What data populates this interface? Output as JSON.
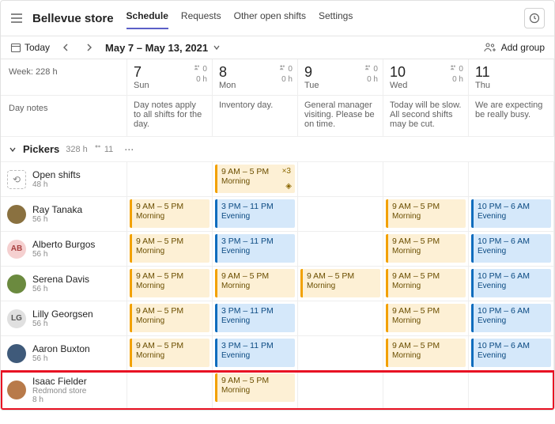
{
  "header": {
    "store_name": "Bellevue store",
    "tabs": [
      "Schedule",
      "Requests",
      "Other open shifts",
      "Settings"
    ],
    "active_tab": 0
  },
  "toolbar": {
    "today_label": "Today",
    "date_range": "May 7 – May 13, 2021",
    "add_group_label": "Add group"
  },
  "week_label": "Week: 228 h",
  "daynotes_label": "Day notes",
  "days": [
    {
      "num": "7",
      "name": "Sun",
      "people": "0",
      "hours": "0 h",
      "note": "Day notes apply to all shifts for the day."
    },
    {
      "num": "8",
      "name": "Mon",
      "people": "0",
      "hours": "0 h",
      "note": "Inventory day."
    },
    {
      "num": "9",
      "name": "Tue",
      "people": "0",
      "hours": "0 h",
      "note": "General manager visiting. Please be on time."
    },
    {
      "num": "10",
      "name": "Wed",
      "people": "0",
      "hours": "0 h",
      "note": "Today will be slow. All second shifts may be cut."
    },
    {
      "num": "11",
      "name": "Thu",
      "people": "",
      "hours": "",
      "note": "We are expecting be really busy."
    }
  ],
  "group": {
    "name": "Pickers",
    "hours": "328 h",
    "people": "11"
  },
  "rows": [
    {
      "kind": "open",
      "name": "Open shifts",
      "sub": "48 h",
      "cells": [
        null,
        {
          "t": "9 AM – 5 PM",
          "l": "Morning",
          "s": "morning",
          "b": "×3",
          "pin": true
        },
        null,
        null,
        null
      ]
    },
    {
      "kind": "p",
      "name": "Ray Tanaka",
      "sub": "56 h",
      "av": "#8a7140",
      "cells": [
        {
          "t": "9 AM – 5 PM",
          "l": "Morning",
          "s": "morning"
        },
        {
          "t": "3 PM – 11 PM",
          "l": "Evening",
          "s": "evening"
        },
        null,
        {
          "t": "9 AM – 5 PM",
          "l": "Morning",
          "s": "morning"
        },
        {
          "t": "10 PM – 6 AM",
          "l": "Evening",
          "s": "evening"
        }
      ]
    },
    {
      "kind": "p",
      "name": "Alberto Burgos",
      "sub": "56 h",
      "av": "#f5d0d0",
      "in": "AB",
      "fg": "#a84040",
      "cells": [
        {
          "t": "9 AM – 5 PM",
          "l": "Morning",
          "s": "morning"
        },
        {
          "t": "3 PM – 11 PM",
          "l": "Evening",
          "s": "evening"
        },
        null,
        {
          "t": "9 AM – 5 PM",
          "l": "Morning",
          "s": "morning"
        },
        {
          "t": "10 PM – 6 AM",
          "l": "Evening",
          "s": "evening"
        }
      ]
    },
    {
      "kind": "p",
      "name": "Serena Davis",
      "sub": "56 h",
      "av": "#6b8a3f",
      "cells": [
        {
          "t": "9 AM – 5 PM",
          "l": "Morning",
          "s": "morning"
        },
        {
          "t": "9 AM – 5 PM",
          "l": "Morning",
          "s": "morning"
        },
        {
          "t": "9 AM – 5 PM",
          "l": "Morning",
          "s": "morning"
        },
        {
          "t": "9 AM – 5 PM",
          "l": "Morning",
          "s": "morning"
        },
        {
          "t": "10 PM – 6 AM",
          "l": "Evening",
          "s": "evening"
        }
      ]
    },
    {
      "kind": "p",
      "name": "Lilly Georgsen",
      "sub": "56 h",
      "av": "#e0e0e0",
      "in": "LG",
      "fg": "#555",
      "cells": [
        {
          "t": "9 AM – 5 PM",
          "l": "Morning",
          "s": "morning"
        },
        {
          "t": "3 PM – 11 PM",
          "l": "Evening",
          "s": "evening"
        },
        null,
        {
          "t": "9 AM – 5 PM",
          "l": "Morning",
          "s": "morning"
        },
        {
          "t": "10 PM – 6 AM",
          "l": "Evening",
          "s": "evening"
        }
      ]
    },
    {
      "kind": "p",
      "name": "Aaron Buxton",
      "sub": "56 h",
      "av": "#3f5a7a",
      "cells": [
        {
          "t": "9 AM – 5 PM",
          "l": "Morning",
          "s": "morning"
        },
        {
          "t": "3 PM – 11 PM",
          "l": "Evening",
          "s": "evening"
        },
        null,
        {
          "t": "9 AM – 5 PM",
          "l": "Morning",
          "s": "morning"
        },
        {
          "t": "10 PM – 6 AM",
          "l": "Evening",
          "s": "evening"
        }
      ]
    }
  ],
  "highlight_row": {
    "name": "Isaac Fielder",
    "sub1": "Redmond store",
    "sub2": "8 h",
    "av": "#b87a4a",
    "cells": [
      null,
      {
        "t": "9 AM – 5 PM",
        "l": "Morning",
        "s": "morning"
      },
      null,
      null,
      null
    ]
  }
}
